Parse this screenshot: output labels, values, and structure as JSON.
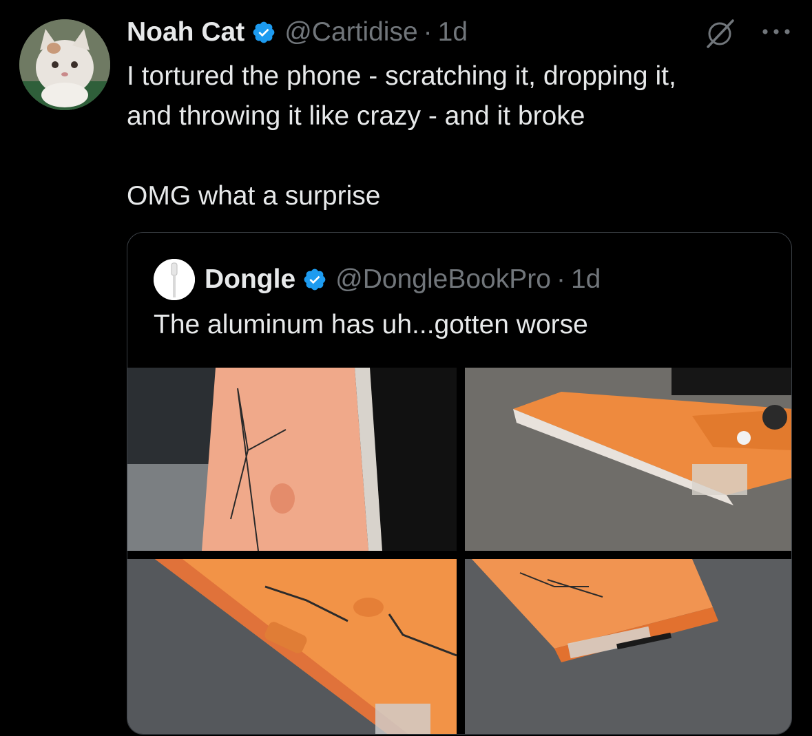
{
  "tweet": {
    "author_name": "Noah Cat",
    "handle": "@Cartidise",
    "separator": "·",
    "time": "1d",
    "text": "I tortured the phone - scratching it, dropping it,\nand throwing it like crazy - and it broke\n\nOMG what a surprise"
  },
  "quoted": {
    "author_name": "Dongle",
    "handle": "@DongleBookPro",
    "separator": "·",
    "time": "1d",
    "text": "The aluminum has uh...gotten worse"
  },
  "colors": {
    "background": "#000000",
    "text_primary": "#e7e9ea",
    "text_secondary": "#71767b",
    "verified": "#1d9bf0",
    "border": "#3b4046",
    "phone_orange": "#f08a3e"
  },
  "icons": {
    "verified": "verified-badge-icon",
    "grok": "grok-icon",
    "more": "more-options-icon",
    "cable": "usb-c-cable-icon"
  }
}
